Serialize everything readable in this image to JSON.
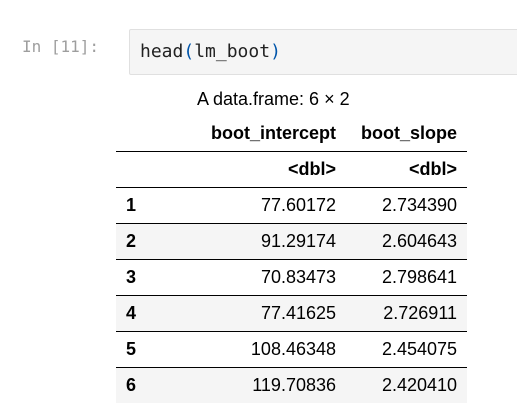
{
  "cell": {
    "prompt": "In [11]:",
    "code_fn": "head",
    "code_open": "(",
    "code_arg": "lm_boot",
    "code_close": ")"
  },
  "output": {
    "caption": "A data.frame: 6 × 2",
    "columns": [
      "boot_intercept",
      "boot_slope"
    ],
    "types": [
      "<dbl>",
      "<dbl>"
    ],
    "rows": [
      {
        "index": "1",
        "boot_intercept": "77.60172",
        "boot_slope": "2.734390"
      },
      {
        "index": "2",
        "boot_intercept": "91.29174",
        "boot_slope": "2.604643"
      },
      {
        "index": "3",
        "boot_intercept": "70.83473",
        "boot_slope": "2.798641"
      },
      {
        "index": "4",
        "boot_intercept": "77.41625",
        "boot_slope": "2.726911"
      },
      {
        "index": "5",
        "boot_intercept": "108.46348",
        "boot_slope": "2.454075"
      },
      {
        "index": "6",
        "boot_intercept": "119.70836",
        "boot_slope": "2.420410"
      }
    ]
  }
}
